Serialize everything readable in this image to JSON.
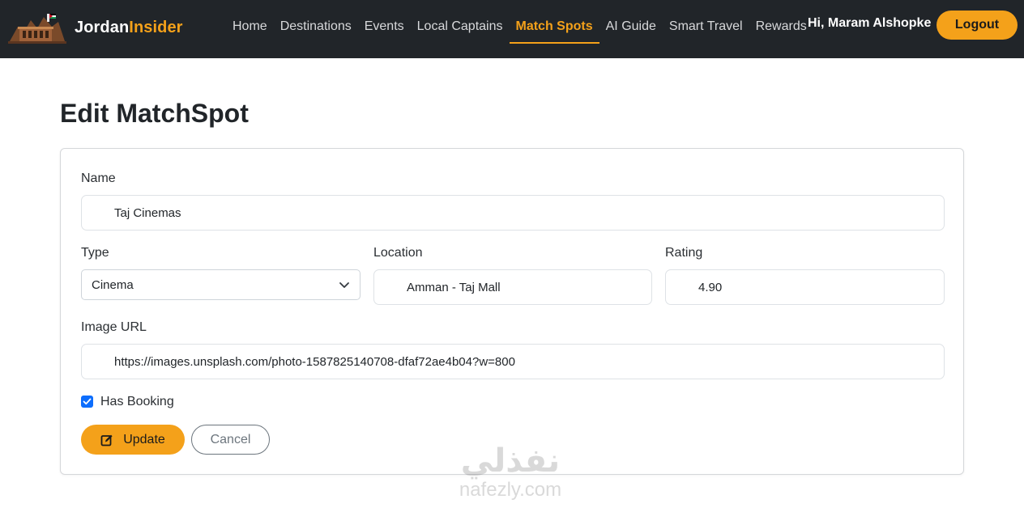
{
  "brand": {
    "name_part1": "Jordan",
    "name_part2": "Insider"
  },
  "nav": {
    "items": [
      {
        "label": "Home"
      },
      {
        "label": "Destinations"
      },
      {
        "label": "Events"
      },
      {
        "label": "Local Captains"
      },
      {
        "label": "Match Spots",
        "active": true
      },
      {
        "label": "AI Guide"
      },
      {
        "label": "Smart Travel"
      },
      {
        "label": "Rewards"
      }
    ],
    "greeting": "Hi, Maram Alshopke",
    "logout_label": "Logout"
  },
  "page": {
    "title": "Edit MatchSpot"
  },
  "form": {
    "name_label": "Name",
    "name_value": "Taj Cinemas",
    "type_label": "Type",
    "type_value": "Cinema",
    "location_label": "Location",
    "location_value": "Amman - Taj Mall",
    "rating_label": "Rating",
    "rating_value": "4.90",
    "image_url_label": "Image URL",
    "image_url_value": "https://images.unsplash.com/photo-1587825140708-dfaf72ae4b04?w=800",
    "has_booking_label": "Has Booking",
    "has_booking_checked": true,
    "update_label": "Update",
    "cancel_label": "Cancel"
  },
  "watermark": {
    "arabic": "نفذلي",
    "latin": "nafezly.com"
  },
  "colors": {
    "navbar": "#212529",
    "accent": "#f4a11a",
    "checkbox": "#0d6efd"
  }
}
